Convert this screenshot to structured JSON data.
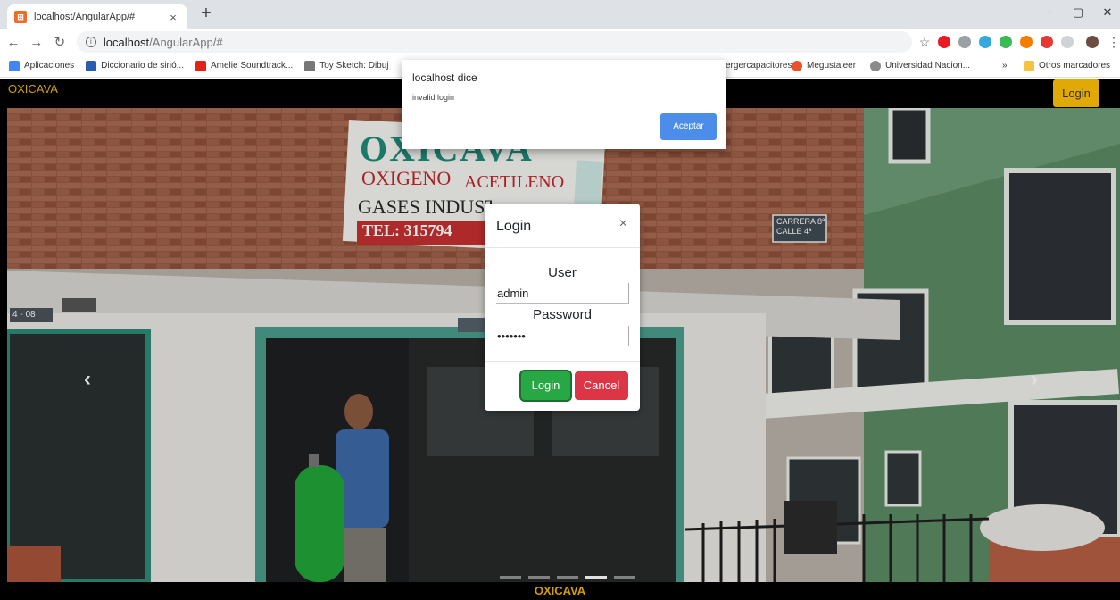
{
  "browser": {
    "tab_title": "localhost/AngularApp/#",
    "tab_close": "×",
    "new_tab": "+",
    "url_host": "localhost",
    "url_path": "/AngularApp/#",
    "window_controls": {
      "minimize": "−",
      "maximize": "▢",
      "close": "✕"
    },
    "bookmarks": [
      {
        "label": "Aplicaciones",
        "icon": "apps-grid-icon",
        "color": "#4285f4"
      },
      {
        "label": "Diccionario de sinó...",
        "icon": "wordreference-icon",
        "color": "#2a5db0"
      },
      {
        "label": "Amelie Soundtrack...",
        "icon": "youtube-icon",
        "color": "#e62117"
      },
      {
        "label": "Toy Sketch: Dibuj",
        "icon": "sketch-icon",
        "color": "#777777"
      },
      {
        "label": "ergercapacitores",
        "icon": "bookmark-icon",
        "color": "#e7a23a"
      },
      {
        "label": "Megustaleer",
        "icon": "megustaleer-icon",
        "color": "#e8542a"
      },
      {
        "label": "Universidad Nacion...",
        "icon": "university-icon",
        "color": "#8a8a8a"
      }
    ],
    "bookmarks_more": "»",
    "other_bookmarks": "Otros marcadores"
  },
  "app": {
    "brand": "OXICAVA",
    "nav_login": "Login",
    "footer": "OXICAVA",
    "carousel": {
      "indicators": 5,
      "active_index": 3,
      "photo": {
        "sign_line1": "OXICAVA",
        "sign_line2a": "OXIGENO",
        "sign_line2b": "ACETILENO",
        "sign_line3": "GASES INDUSTRIALES",
        "sign_line4": "TEL: 315794",
        "street_sign_1": "CARRERA 8ª",
        "street_sign_2": "CALLE 4ª",
        "house_number": "4 - 08"
      }
    }
  },
  "login_modal": {
    "title": "Login",
    "close": "×",
    "user_label": "User",
    "user_value": "admin",
    "password_label": "Password",
    "password_value": "•••••••",
    "login_button": "Login",
    "cancel_button": "Cancel"
  },
  "alert": {
    "title": "localhost dice",
    "message": "invalid login",
    "button": "Aceptar"
  }
}
